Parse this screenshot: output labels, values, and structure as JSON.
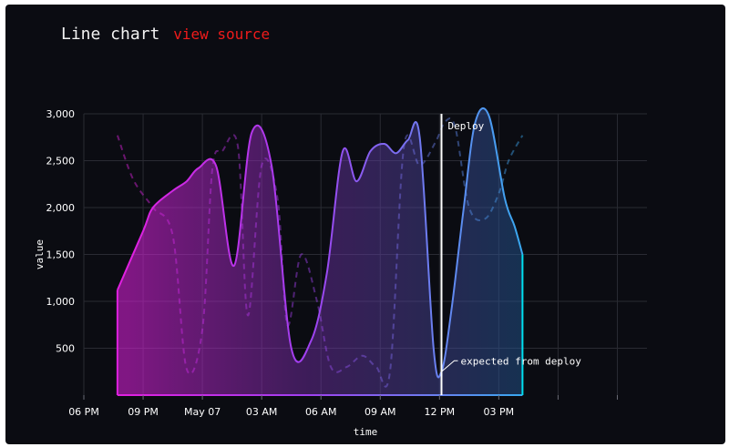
{
  "header": {
    "title": "Line chart",
    "link_label": "view source"
  },
  "colors": {
    "background": "#0b0c12",
    "grid": "#2a2b33",
    "gradient_stops": [
      "#e020e0",
      "#8a5cf0",
      "#3aa0f0",
      "#00e0f0"
    ],
    "link": "#ef1b1b"
  },
  "chart_data": {
    "type": "area",
    "xlabel": "time",
    "ylabel": "value",
    "ylim": [
      0,
      3000
    ],
    "y_ticks": [
      500,
      1000,
      1500,
      2000,
      2500,
      3000
    ],
    "y_tick_labels": [
      "500",
      "1,000",
      "1,500",
      "2,000",
      "2,500",
      "3,000"
    ],
    "xlim": [
      -6,
      22.5
    ],
    "x_ticks": [
      -6,
      -3,
      0,
      3,
      6,
      9,
      12,
      15,
      18,
      21
    ],
    "x_tick_labels": [
      "06 PM",
      "09 PM",
      "May 07",
      "03 AM",
      "06 AM",
      "09 AM",
      "12 PM",
      "03 PM"
    ],
    "x_tick_label_values": [
      -6,
      -3,
      0,
      3,
      6,
      9,
      12,
      15
    ],
    "grid": true,
    "series": [
      {
        "x": [
          -4.3,
          -3.0,
          -2.5,
          -1.5,
          -0.8,
          -0.2,
          0.7,
          1.6,
          2.5,
          3.5,
          4.5,
          5.5,
          6.3,
          7.1,
          7.8,
          8.5,
          9.2,
          9.8,
          10.4,
          11.0,
          11.7,
          12.1,
          12.6,
          13.2,
          13.8,
          14.5,
          15.3,
          15.8,
          16.2
        ],
        "y": [
          1120,
          1750,
          2000,
          2180,
          2280,
          2420,
          2440,
          1380,
          2800,
          2450,
          500,
          580,
          1300,
          2600,
          2280,
          2600,
          2680,
          2580,
          2720,
          2750,
          500,
          250,
          900,
          1950,
          2900,
          2980,
          2100,
          1800,
          1500
        ]
      },
      {
        "x": [
          -4.3,
          -3.5,
          -2.5,
          -1.5,
          -0.8,
          0.0,
          0.5,
          1.0,
          1.8,
          2.3,
          3.0,
          3.8,
          4.3,
          5.0,
          5.8,
          6.5,
          7.3,
          8.1,
          8.8,
          9.5,
          10.2,
          11.0,
          11.8,
          12.3,
          12.8,
          13.5,
          14.3,
          15.0,
          15.5,
          16.2
        ],
        "y": [
          2770,
          2300,
          2000,
          1700,
          280,
          700,
          2400,
          2600,
          2650,
          850,
          2450,
          2100,
          750,
          1500,
          1000,
          300,
          300,
          420,
          300,
          260,
          2650,
          2450,
          2700,
          2920,
          2850,
          2000,
          1880,
          2150,
          2500,
          2770
        ]
      }
    ],
    "annotations": [
      {
        "type": "vline",
        "x": 12.1,
        "label": "Deploy"
      },
      {
        "type": "point",
        "x": 12.1,
        "y": 250,
        "label": "expected from deploy"
      }
    ]
  }
}
